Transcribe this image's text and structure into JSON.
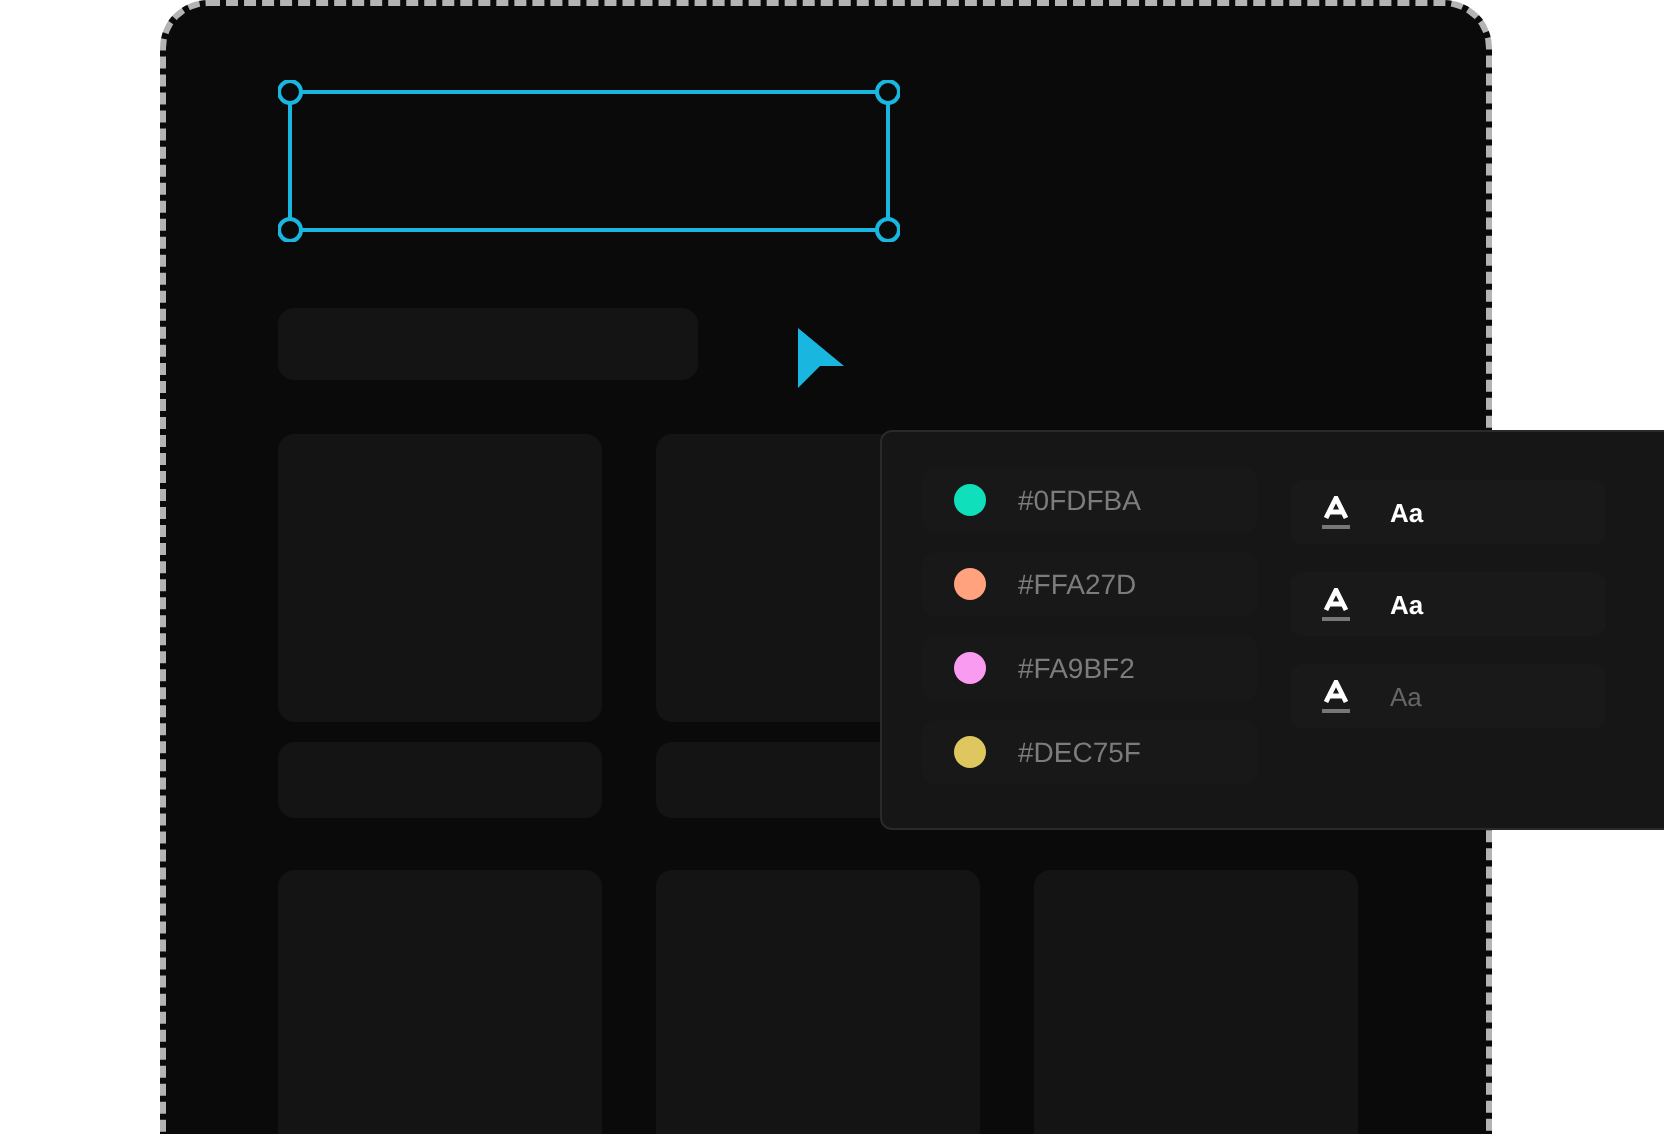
{
  "swatches": [
    {
      "hex": "#0FDFBA",
      "color": "#0fdfba"
    },
    {
      "hex": "#FFA27D",
      "color": "#ffa27d"
    },
    {
      "hex": "#FA9BF2",
      "color": "#fa9bf2"
    },
    {
      "hex": "#DEC75F",
      "color": "#dec75f"
    }
  ],
  "text_styles": [
    {
      "sample": "Aa",
      "active": true
    },
    {
      "sample": "Aa",
      "active": true
    },
    {
      "sample": "Aa",
      "active": false
    }
  ]
}
